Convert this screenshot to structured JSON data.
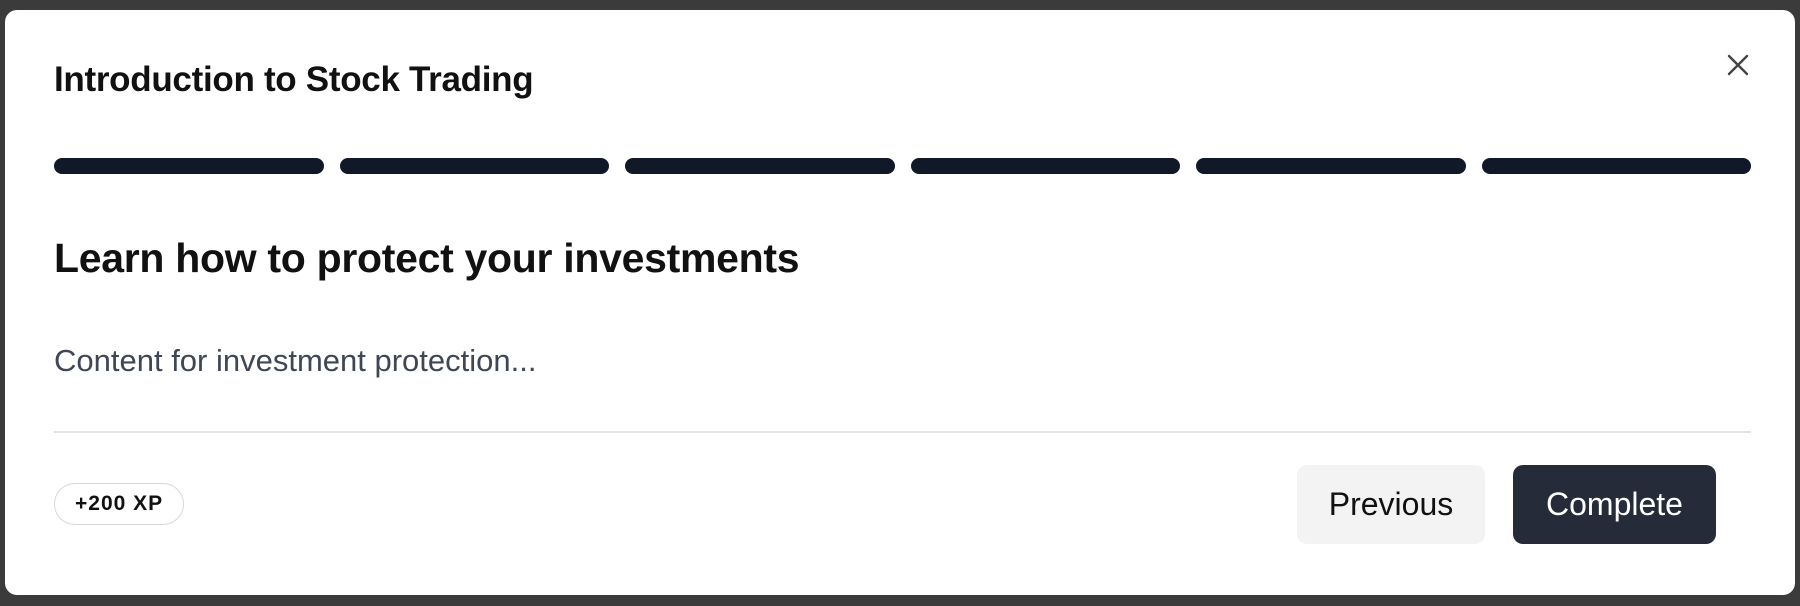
{
  "modal": {
    "title": "Introduction to Stock Trading",
    "close_icon": "close-icon",
    "progress": {
      "total_steps": 6,
      "completed_steps": 6,
      "color": "#111827"
    },
    "step": {
      "heading": "Learn how to protect your investments",
      "content": "Content for investment protection..."
    },
    "footer": {
      "xp_badge": "+200 XP",
      "previous_label": "Previous",
      "complete_label": "Complete"
    }
  }
}
